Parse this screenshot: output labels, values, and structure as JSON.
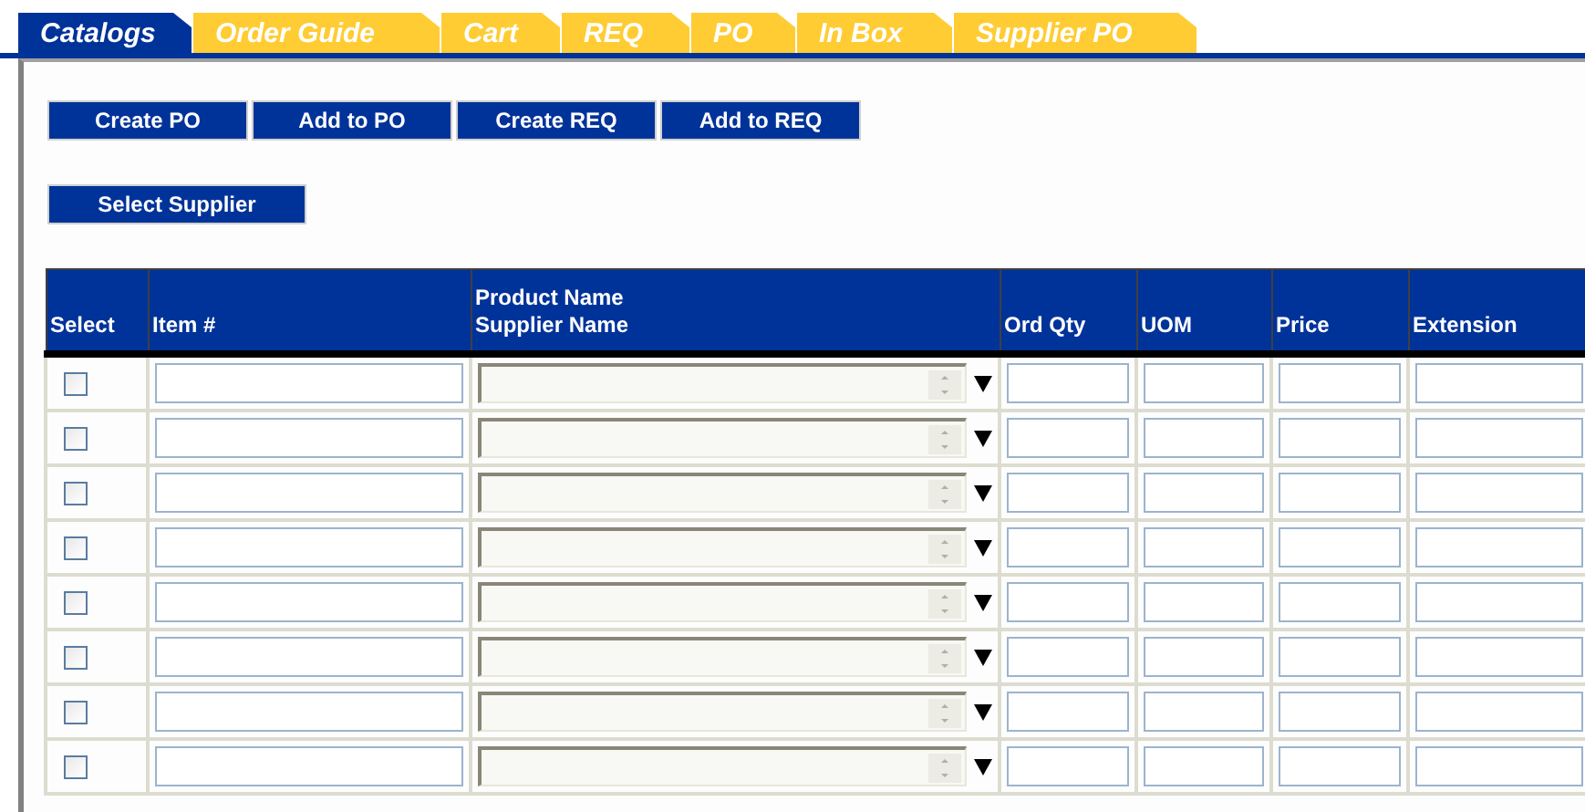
{
  "tabs": [
    {
      "label": "Catalogs",
      "selected": true
    },
    {
      "label": "Order Guide",
      "selected": false
    },
    {
      "label": "Cart",
      "selected": false
    },
    {
      "label": "REQ",
      "selected": false
    },
    {
      "label": "PO",
      "selected": false
    },
    {
      "label": "In Box",
      "selected": false
    },
    {
      "label": "Supplier PO",
      "selected": false
    }
  ],
  "actions": [
    "Create PO",
    "Add to PO",
    "Create REQ",
    "Add to REQ"
  ],
  "select_supplier": "Select Supplier",
  "table": {
    "columns": [
      "Select",
      "Item #",
      "Product Name\nSupplier Name",
      "Ord Qty",
      "UOM",
      "Price",
      "Extension"
    ],
    "rows": [
      {
        "checked": false
      },
      {
        "checked": false
      },
      {
        "checked": false
      },
      {
        "checked": false
      },
      {
        "checked": false
      },
      {
        "checked": false
      },
      {
        "checked": false
      },
      {
        "checked": false
      }
    ]
  }
}
